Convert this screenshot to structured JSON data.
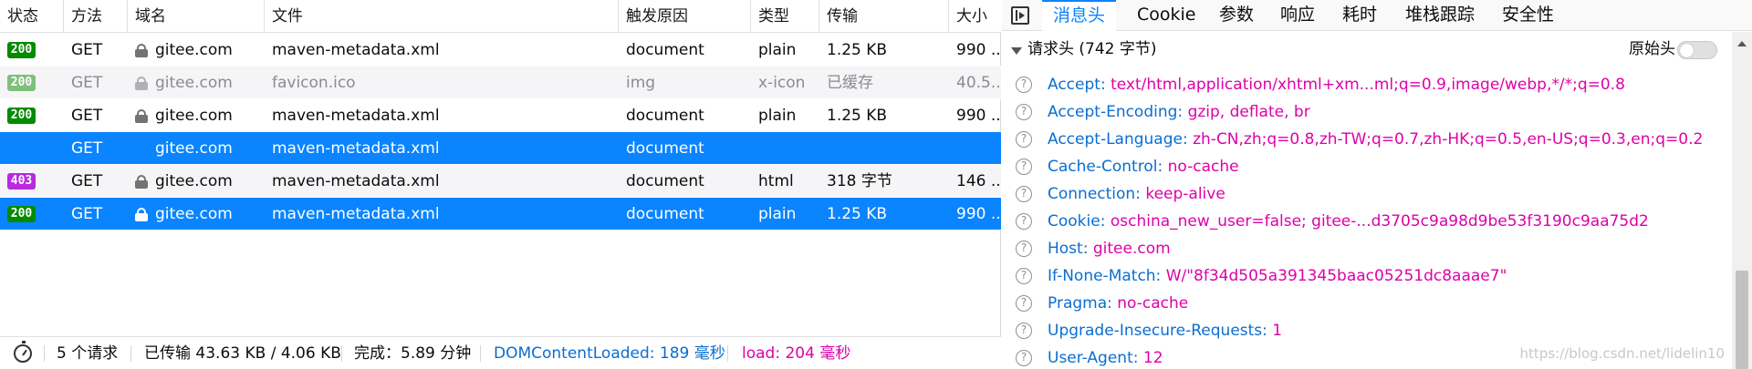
{
  "columns": [
    "状态",
    "方法",
    "域名",
    "文件",
    "触发原因",
    "类型",
    "传输",
    "大小"
  ],
  "requests": [
    {
      "status": "200",
      "method": "GET",
      "domain": "gitee.com",
      "file": "maven-metadata.xml",
      "cause": "document",
      "type": "plain",
      "transferred": "1.25 KB",
      "size": "990 ..."
    },
    {
      "status": "200",
      "method": "GET",
      "domain": "gitee.com",
      "file": "favicon.ico",
      "cause": "img",
      "type": "x-icon",
      "transferred": "已缓存",
      "size": "40.5..."
    },
    {
      "status": "200",
      "method": "GET",
      "domain": "gitee.com",
      "file": "maven-metadata.xml",
      "cause": "document",
      "type": "plain",
      "transferred": "1.25 KB",
      "size": "990 ..."
    },
    {
      "status": "",
      "method": "GET",
      "domain": "gitee.com",
      "file": "maven-metadata.xml",
      "cause": "document",
      "type": "",
      "transferred": "",
      "size": ""
    },
    {
      "status": "403",
      "method": "GET",
      "domain": "gitee.com",
      "file": "maven-metadata.xml",
      "cause": "document",
      "type": "html",
      "transferred": "318 字节",
      "size": "146 ..."
    },
    {
      "status": "200",
      "method": "GET",
      "domain": "gitee.com",
      "file": "maven-metadata.xml",
      "cause": "document",
      "type": "plain",
      "transferred": "1.25 KB",
      "size": "990 ..."
    }
  ],
  "statusbar": {
    "requests": "5 个请求",
    "transferred": "已传输 43.63 KB / 4.06 KB",
    "finish": "完成：5.89 分钟",
    "dom": "DOMContentLoaded: 189 毫秒",
    "load": "load: 204 毫秒"
  },
  "tabs": [
    "消息头",
    "Cookie",
    "参数",
    "响应",
    "耗时",
    "堆栈跟踪",
    "安全性"
  ],
  "section": {
    "title": "请求头 (742 字节)",
    "raw_label": "原始头"
  },
  "headers": [
    {
      "name": "Accept:",
      "value": "text/html,application/xhtml+xm...ml;q=0.9,image/webp,*/*;q=0.8"
    },
    {
      "name": "Accept-Encoding:",
      "value": "gzip, deflate, br"
    },
    {
      "name": "Accept-Language:",
      "value": "zh-CN,zh;q=0.8,zh-TW;q=0.7,zh-HK;q=0.5,en-US;q=0.3,en;q=0.2"
    },
    {
      "name": "Cache-Control:",
      "value": "no-cache"
    },
    {
      "name": "Connection:",
      "value": "keep-alive"
    },
    {
      "name": "Cookie:",
      "value": "oschina_new_user=false; gitee-...d3705c9a98d9be53f3190c9aa75d2"
    },
    {
      "name": "Host:",
      "value": "gitee.com"
    },
    {
      "name": "If-None-Match:",
      "value": "W/\"8f34d505a391345baac05251dc8aaae7\""
    },
    {
      "name": "Pragma:",
      "value": "no-cache"
    },
    {
      "name": "Upgrade-Insecure-Requests:",
      "value": "1"
    },
    {
      "name": "User-Agent:",
      "value": "12"
    }
  ],
  "watermark": "https://blog.csdn.net/lidelin10",
  "colors": {
    "accent": "#0a84ff",
    "header_name": "#0a6ed1",
    "header_value": "#dd00a9",
    "status_ok": "#058b00",
    "status_forbidden": "#b82ae0"
  }
}
